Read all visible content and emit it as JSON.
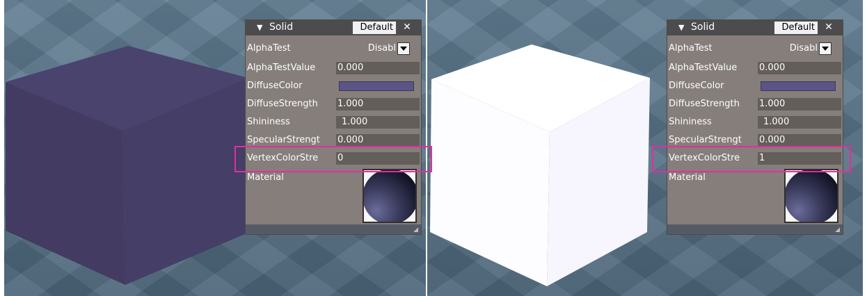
{
  "panels": [
    {
      "header": {
        "title": "Solid",
        "preset": "Default",
        "close_glyph": "✕"
      },
      "rows": {
        "alpha_test": {
          "label": "AlphaTest",
          "value": "Disabl"
        },
        "alpha_test_value": {
          "label": "AlphaTestValue",
          "value": "0.000"
        },
        "diffuse_color": {
          "label": "DiffuseColor",
          "color": "#5b5486"
        },
        "diffuse_strength": {
          "label": "DiffuseStrength",
          "value": "1.000"
        },
        "shininess": {
          "label": "Shininess",
          "value": "1.000"
        },
        "specular_strength": {
          "label": "SpecularStrengt",
          "value": "0.000"
        },
        "vertex_color_strength": {
          "label": "VertexColorStre",
          "value": "0"
        },
        "material": {
          "label": "Material"
        }
      }
    },
    {
      "header": {
        "title": "Solid",
        "preset": "Default",
        "close_glyph": "✕"
      },
      "rows": {
        "alpha_test": {
          "label": "AlphaTest",
          "value": "Disabl"
        },
        "alpha_test_value": {
          "label": "AlphaTestValue",
          "value": "0.000"
        },
        "diffuse_color": {
          "label": "DiffuseColor",
          "color": "#5b5486"
        },
        "diffuse_strength": {
          "label": "DiffuseStrength",
          "value": "1.000"
        },
        "shininess": {
          "label": "Shininess",
          "value": "1.000"
        },
        "specular_strength": {
          "label": "SpecularStrengt",
          "value": "0.000"
        },
        "vertex_color_strength": {
          "label": "VertexColorStre",
          "value": "1"
        },
        "material": {
          "label": "Material"
        }
      }
    }
  ],
  "colors": {
    "viewport_background": "#56748a",
    "cube_left": "#473f6a",
    "cube_right": "#ffffff",
    "highlight": "#e62ca0"
  }
}
